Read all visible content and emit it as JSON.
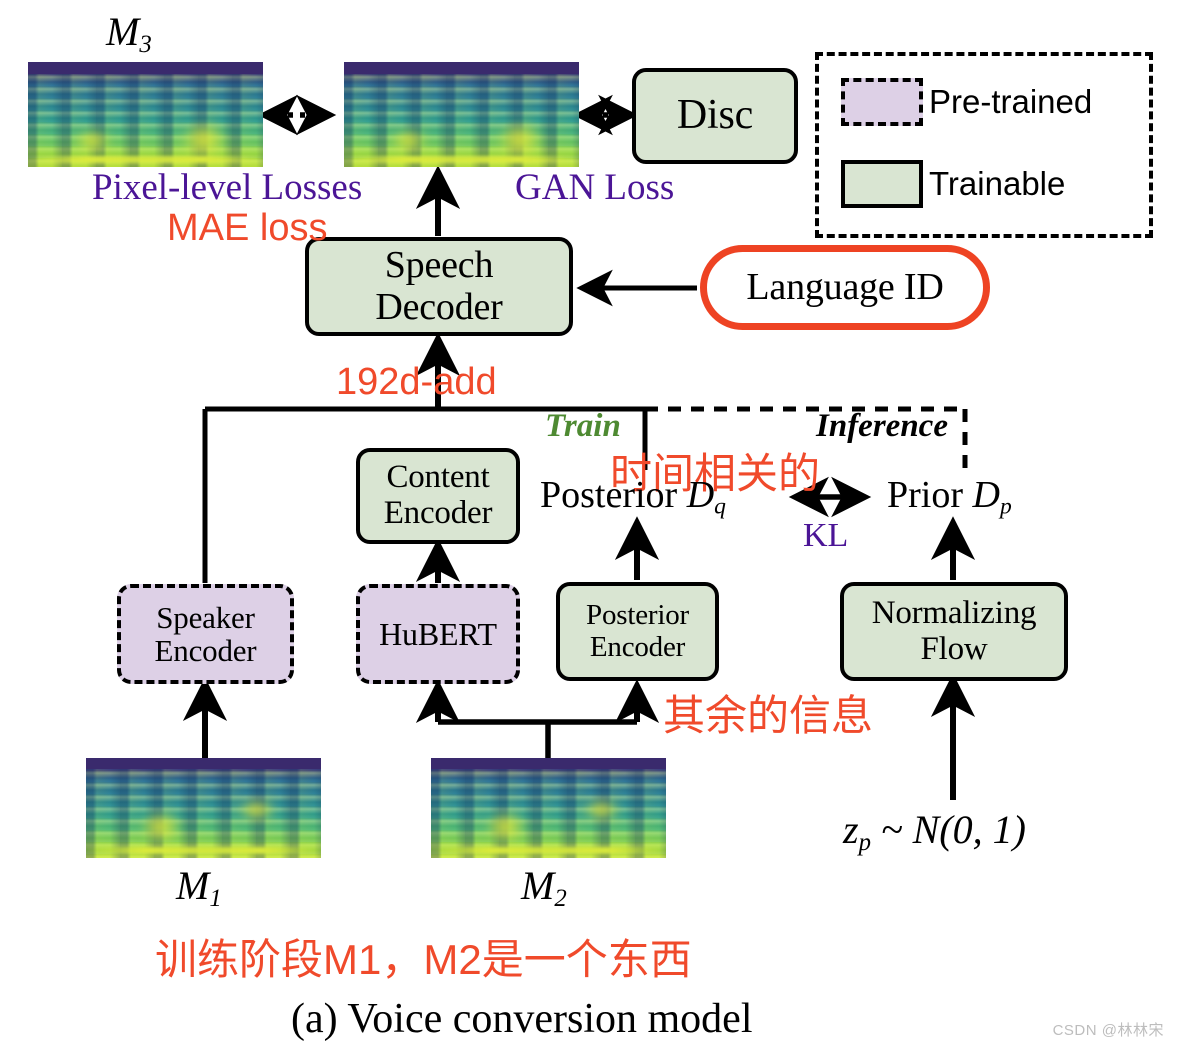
{
  "figure": {
    "caption": "(a) Voice conversion model",
    "watermark": "CSDN @林林宋"
  },
  "legend": {
    "items": [
      {
        "label": "Pre-trained",
        "style": "dashed",
        "color": "#ddd0e6"
      },
      {
        "label": "Trainable",
        "style": "solid",
        "color": "#d9e5d2"
      }
    ]
  },
  "colors": {
    "trainable_fill": "#d9e5d2",
    "pretrained_fill": "#ddd0e6",
    "annotation_red": "#f04a2b",
    "loss_purple": "#4b1596",
    "train_green": "#4e8a32",
    "language_id_border": "#ee4323",
    "stroke_black": "#000000"
  },
  "nodes": {
    "disc": {
      "label": "Disc",
      "type": "trainable"
    },
    "speech_decoder": {
      "label_line1": "Speech",
      "label_line2": "Decoder",
      "type": "trainable"
    },
    "language_id": {
      "label": "Language ID",
      "type": "pill"
    },
    "content_encoder": {
      "label_line1": "Content",
      "label_line2": "Encoder",
      "type": "trainable"
    },
    "speaker_encoder": {
      "label_line1": "Speaker",
      "label_line2": "Encoder",
      "type": "pretrained"
    },
    "hubert": {
      "label": "HuBERT",
      "type": "pretrained"
    },
    "posterior_encoder": {
      "label_line1": "Posterior",
      "label_line2": "Encoder",
      "type": "trainable"
    },
    "normalizing_flow": {
      "label_line1": "Normalizing",
      "label_line2": "Flow",
      "type": "trainable"
    }
  },
  "spectrograms": {
    "m3_target": {
      "caption": "M3",
      "caption_base": "M",
      "caption_sub": "3"
    },
    "m3_generated": {
      "caption": ""
    },
    "m1": {
      "caption_base": "M",
      "caption_sub": "1"
    },
    "m2": {
      "caption_base": "M",
      "caption_sub": "2"
    }
  },
  "labels": {
    "pixel_level_losses": "Pixel-level Losses",
    "gan_loss": "GAN Loss",
    "mae_loss": "MAE loss",
    "dim_add": "192d-add",
    "train": "Train",
    "inference": "Inference",
    "kl": "KL",
    "time_related_cn": "时间相关的",
    "rest_info_cn": "其余的信息",
    "training_stage_cn": "训练阶段M1，M2是一个东西",
    "posterior_base": "Posterior ",
    "posterior_sym": "D",
    "posterior_sub": "q",
    "prior_base": "Prior ",
    "prior_sym": "D",
    "prior_sub": "p",
    "zp_sym": "z",
    "zp_sub": "p",
    "zp_rest": " ~ N(0, 1)"
  }
}
